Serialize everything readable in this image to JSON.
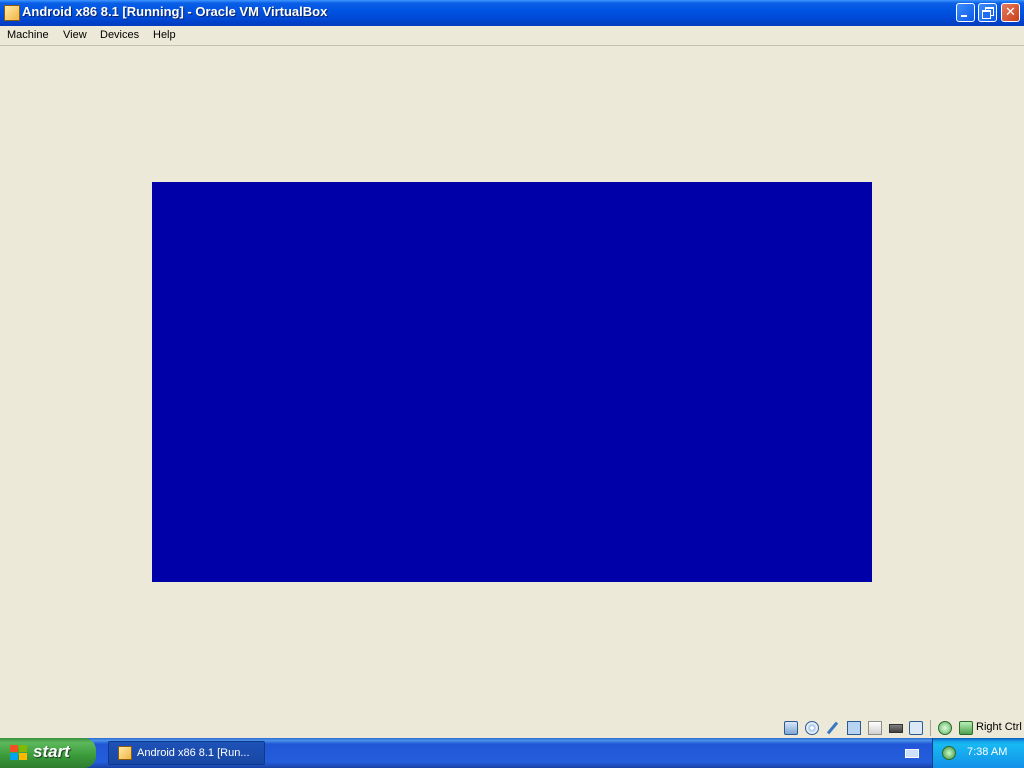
{
  "window": {
    "title": "Android x86 8.1 [Running] - Oracle VM VirtualBox",
    "icon": "virtualbox-icon",
    "controls": {
      "minimize": "minimize-icon",
      "maximize": "restore-icon",
      "close_label": "✕"
    }
  },
  "menu": {
    "items": [
      "Machine",
      "View",
      "Devices",
      "Help"
    ]
  },
  "vm_display": {
    "background_color": "#0000a8"
  },
  "statusbar": {
    "icons": [
      "hard-disk-icon",
      "optical-drive-icon",
      "pen-icon",
      "network-icon",
      "shared-folder-icon",
      "display-icon",
      "usb-icon",
      "mouse-integration-icon",
      "keyboard-capture-icon"
    ],
    "host_key": "Right Ctrl"
  },
  "taskbar": {
    "start_label": "start",
    "task_label": "Android x86 8.1 [Run...",
    "clock": "7:38 AM"
  }
}
